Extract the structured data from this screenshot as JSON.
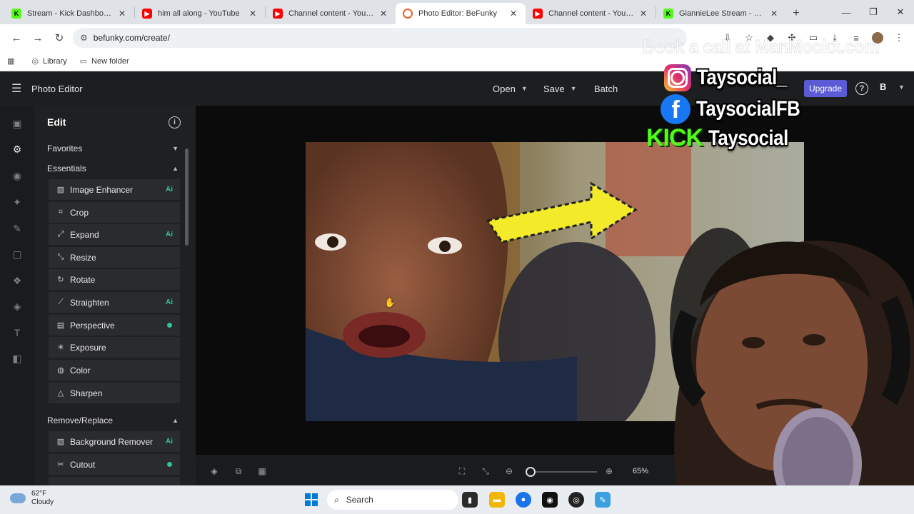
{
  "browser": {
    "tabs": [
      {
        "title": "Stream - Kick Dashboard",
        "favicon": "kick-icon"
      },
      {
        "title": "him all along - YouTube",
        "favicon": "youtube-icon"
      },
      {
        "title": "Channel content - YouTube",
        "favicon": "youtube-icon"
      },
      {
        "title": "Photo Editor: BeFunky",
        "favicon": "befunky-icon",
        "active": true
      },
      {
        "title": "Channel content - YouTube",
        "favicon": "youtube-icon"
      },
      {
        "title": "GiannieLee Stream - Watch",
        "favicon": "kick-icon"
      }
    ],
    "url": "befunky.com/create/",
    "bookmarks": [
      "Library",
      "New folder"
    ]
  },
  "app": {
    "title": "Photo Editor",
    "menu": {
      "open": "Open",
      "save": "Save",
      "batch": "Batch"
    },
    "upgrade": "Upgrade",
    "user_initial": "B",
    "accent_color": "#5b5bd6"
  },
  "panel": {
    "title": "Edit",
    "sections": {
      "favorites": "Favorites",
      "essentials": "Essentials",
      "remove_replace": "Remove/Replace"
    },
    "essentials_tools": [
      {
        "label": "Image Enhancer",
        "badge": "Ai"
      },
      {
        "label": "Crop",
        "badge": ""
      },
      {
        "label": "Expand",
        "badge": "Ai"
      },
      {
        "label": "Resize",
        "badge": ""
      },
      {
        "label": "Rotate",
        "badge": ""
      },
      {
        "label": "Straighten",
        "badge": "Ai"
      },
      {
        "label": "Perspective",
        "badge": "dot"
      },
      {
        "label": "Exposure",
        "badge": ""
      },
      {
        "label": "Color",
        "badge": ""
      },
      {
        "label": "Sharpen",
        "badge": ""
      }
    ],
    "remove_tools": [
      {
        "label": "Background Remover",
        "badge": "Ai"
      },
      {
        "label": "Cutout",
        "badge": "dot"
      }
    ],
    "ai_color": "#31c48d"
  },
  "bottombar": {
    "zoom": "65%"
  },
  "overlay": {
    "instagram": "Taysocial_",
    "facebook": "TaysocialFB",
    "kick_word": "KICK",
    "kick": "Taysocial",
    "watermark": "Book a call at ManMockx.com"
  },
  "taskbar": {
    "temp": "62°F",
    "condition": "Cloudy",
    "search": "Search"
  }
}
